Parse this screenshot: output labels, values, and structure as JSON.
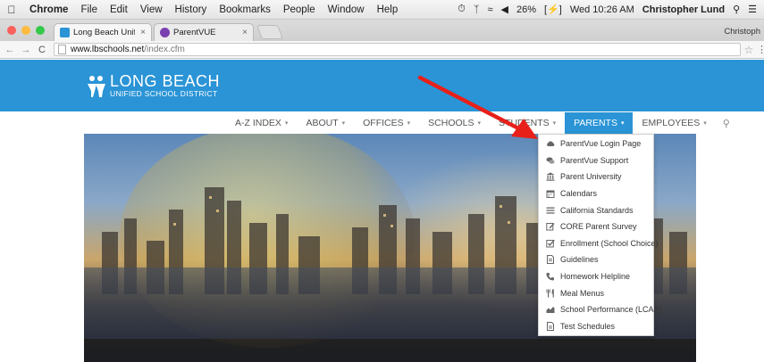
{
  "menubar": {
    "app_name": "Chrome",
    "items": [
      "File",
      "Edit",
      "View",
      "History",
      "Bookmarks",
      "People",
      "Window",
      "Help"
    ],
    "battery": "26%",
    "datetime": "Wed 10:26 AM",
    "user": "Christopher Lund"
  },
  "tabs": [
    {
      "label": "Long Beach Unified Schoo",
      "active": true,
      "favicon_color": "#2a94d6"
    },
    {
      "label": "ParentVUE",
      "active": false,
      "favicon_color": "#7a3fb0"
    }
  ],
  "profile_name": "Christoph",
  "address_bar": {
    "domain": "www.lbschools.net",
    "path": "/index.cfm"
  },
  "site": {
    "logo_line1": "LONG BEACH",
    "logo_line2": "UNIFIED SCHOOL DISTRICT",
    "brand_color": "#2a94d6"
  },
  "nav": {
    "items": [
      {
        "label": "A-Z INDEX"
      },
      {
        "label": "ABOUT"
      },
      {
        "label": "OFFICES"
      },
      {
        "label": "SCHOOLS"
      },
      {
        "label": "STUDENTS"
      },
      {
        "label": "PARENTS",
        "active": true
      },
      {
        "label": "EMPLOYEES"
      }
    ]
  },
  "dropdown": {
    "items": [
      {
        "label": "ParentVue Login Page",
        "icon": "cloud-icon"
      },
      {
        "label": "ParentVue Support",
        "icon": "chat-icon"
      },
      {
        "label": "Parent University",
        "icon": "building-icon"
      },
      {
        "label": "Calendars",
        "icon": "calendar-icon"
      },
      {
        "label": "California Standards",
        "icon": "list-icon"
      },
      {
        "label": "CORE Parent Survey",
        "icon": "edit-icon"
      },
      {
        "label": "Enrollment (School Choice)",
        "icon": "checkbox-icon"
      },
      {
        "label": "Guidelines",
        "icon": "document-icon"
      },
      {
        "label": "Homework Helpline",
        "icon": "phone-icon"
      },
      {
        "label": "Meal Menus",
        "icon": "utensils-icon"
      },
      {
        "label": "School Performance (LCAP)",
        "icon": "chart-icon"
      },
      {
        "label": "Test Schedules",
        "icon": "file-icon"
      }
    ]
  },
  "annotation": {
    "arrow_color": "#e8201a"
  }
}
